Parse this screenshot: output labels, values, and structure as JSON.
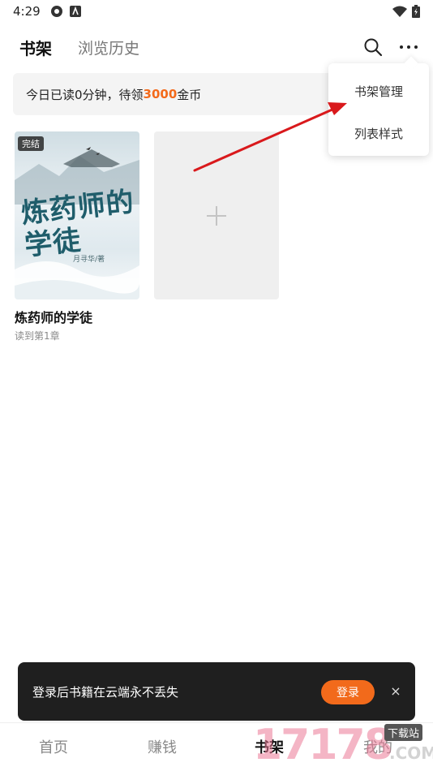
{
  "status_bar": {
    "time": "4:29"
  },
  "header": {
    "tab_active": "书架",
    "tab_inactive": "浏览历史"
  },
  "banner": {
    "prefix": "今日已读0分钟，待领",
    "coins": "3000",
    "suffix": "金币"
  },
  "books": [
    {
      "badge": "完结",
      "cover_title": "炼药师的学徒",
      "cover_author": "月寻华/著",
      "name": "炼药师的学徒",
      "progress": "读到第1章"
    }
  ],
  "menu": {
    "items": [
      "书架管理",
      "列表样式"
    ]
  },
  "toast": {
    "text": "登录后书籍在云端永不丢失",
    "login_label": "登录",
    "close_glyph": "×"
  },
  "bottom_nav": {
    "items": [
      "首页",
      "赚钱",
      "书架",
      "我的"
    ]
  },
  "watermark": {
    "digits": "17178",
    "badge": "下载站",
    "domain": ".COM"
  },
  "colors": {
    "accent": "#f26a1b",
    "arrow": "#d9191c"
  }
}
